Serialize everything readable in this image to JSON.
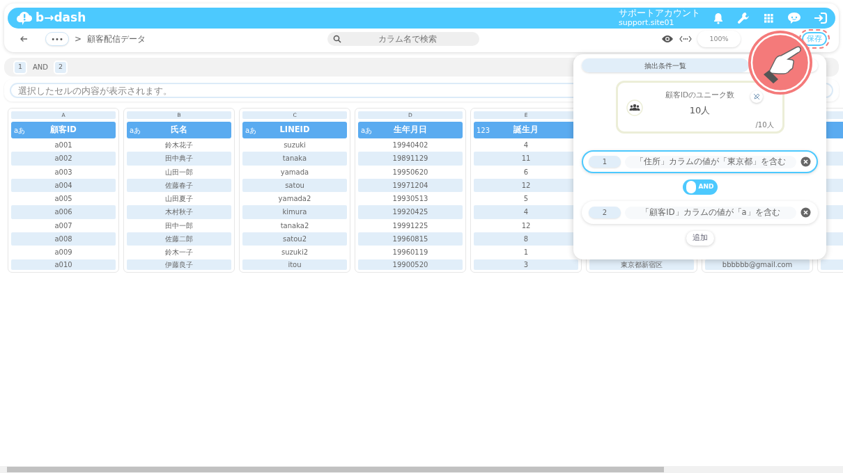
{
  "app_bar": {
    "logo_text": "b→dash",
    "account_name": "サポートアカウント",
    "account_id": "support.site01"
  },
  "toolbar": {
    "breadcrumb_more": "•••",
    "breadcrumb_separator": ">",
    "breadcrumb_current": "顧客配信データ",
    "search": {
      "placeholder": "カラム名で検索"
    },
    "zoom": "100%",
    "save_button": {
      "label": "保存",
      "highlighted": true
    }
  },
  "filter_bar": {
    "chips": [
      {
        "label": "1",
        "kind": "chip"
      },
      {
        "label": "AND",
        "kind": "operator"
      },
      {
        "label": "2",
        "kind": "chip"
      }
    ]
  },
  "cell_viewer": {
    "placeholder": "選択したセルの内容が表示されます。"
  },
  "columns": [
    {
      "letter": "A",
      "type_icon": "aあ",
      "header": "顧客ID",
      "cells": [
        "a001",
        "a002",
        "a003",
        "a004",
        "a005",
        "a006",
        "a007",
        "a008",
        "a009",
        "a010"
      ]
    },
    {
      "letter": "B",
      "type_icon": "aあ",
      "header": "氏名",
      "cells": [
        "鈴木花子",
        "田中典子",
        "山田一郎",
        "佐藤春子",
        "山田夏子",
        "木村秋子",
        "田中一郎",
        "佐藤二郎",
        "鈴木一子",
        "伊藤良子"
      ]
    },
    {
      "letter": "C",
      "type_icon": "aあ",
      "header": "LINEID",
      "cells": [
        "suzuki",
        "tanaka",
        "yamada",
        "satou",
        "yamada2",
        "kimura",
        "tanaka2",
        "satou2",
        "suzuki2",
        "itou"
      ]
    },
    {
      "letter": "D",
      "type_icon": "aあ",
      "header": "生年月日",
      "cells": [
        "19940402",
        "19891129",
        "19950620",
        "19971204",
        "19930513",
        "19920425",
        "19991225",
        "19960815",
        "19960119",
        "19900520"
      ]
    },
    {
      "letter": "E",
      "type_icon": "123",
      "header": "誕生月",
      "cells": [
        "4",
        "11",
        "6",
        "12",
        "5",
        "4",
        "12",
        "8",
        "1",
        "3"
      ]
    }
  ],
  "covered_columns": [
    {
      "last_cell": "東京都新宿区"
    },
    {
      "last_cell": "bbbbbb@gmail.com"
    }
  ],
  "condition_panel": {
    "tabs": [
      {
        "label": "抽出条件一覧",
        "selected": true
      }
    ],
    "stat": {
      "title": "顧客IDのユニーク数",
      "value": "10人",
      "total": "/10人"
    },
    "conditions": [
      {
        "number": "1",
        "text": "「住所」カラムの値が「東京都」を含む",
        "selected": true
      },
      {
        "number": "2",
        "text": "「顧客ID」カラムの値が「a」を含む",
        "selected": false
      }
    ],
    "operator": {
      "label": "AND"
    },
    "add_button": "追加"
  }
}
